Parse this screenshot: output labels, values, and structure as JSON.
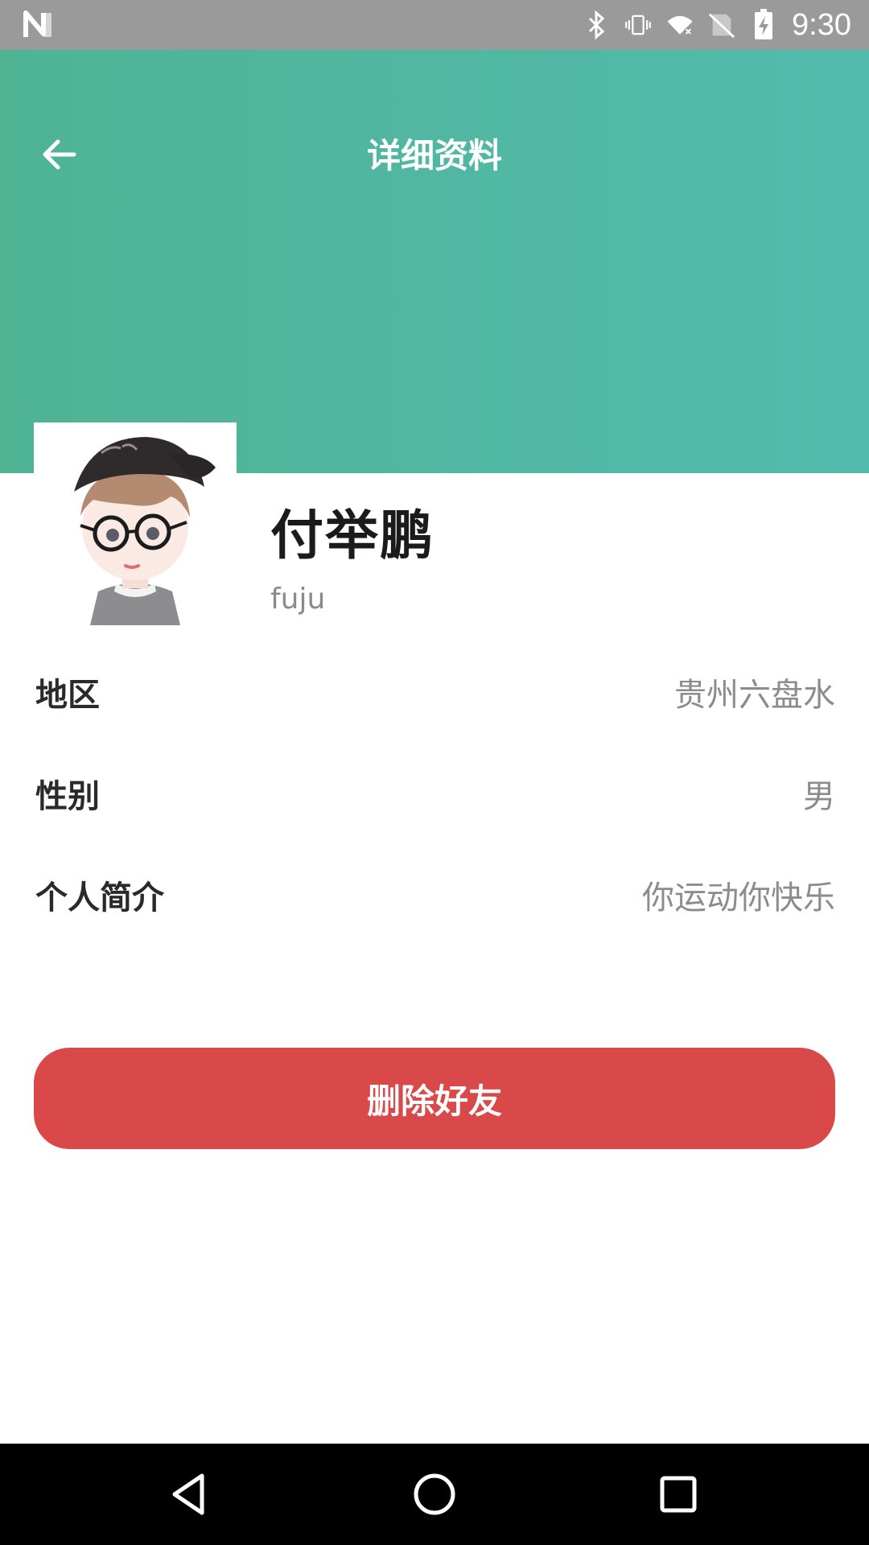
{
  "status_bar": {
    "time": "9:30",
    "icons": [
      "n-logo-icon",
      "bluetooth-icon",
      "vibrate-icon",
      "wifi-off-icon",
      "no-sim-icon",
      "battery-charging-icon"
    ]
  },
  "header": {
    "title": "详细资料",
    "back_icon": "arrow-left-icon",
    "gradient": [
      "#4fb394",
      "#53bbae"
    ]
  },
  "profile": {
    "display_name": "付举鹏",
    "username": "fuju",
    "avatar": "cartoon-avatar"
  },
  "info": [
    {
      "label": "地区",
      "value": "贵州六盘水"
    },
    {
      "label": "性别",
      "value": "男"
    },
    {
      "label": "个人简介",
      "value": "你运动你快乐"
    }
  ],
  "actions": {
    "delete_label": "删除好友",
    "delete_color": "#d9494a"
  },
  "nav_bar": {
    "icons": [
      "back-triangle-icon",
      "home-circle-icon",
      "recents-square-icon"
    ]
  }
}
